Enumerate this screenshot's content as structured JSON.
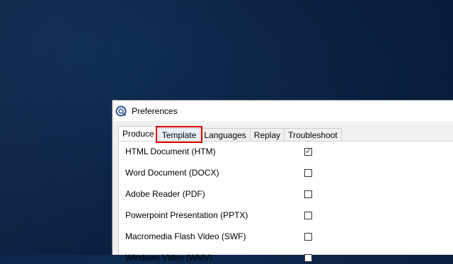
{
  "window": {
    "title": "Preferences"
  },
  "tabs": [
    {
      "label": "Produce"
    },
    {
      "label": "Template"
    },
    {
      "label": "Languages"
    },
    {
      "label": "Replay"
    },
    {
      "label": "Troubleshoot"
    }
  ],
  "options": [
    {
      "label": "HTML Document (HTM)",
      "checked": true
    },
    {
      "label": "Word Document (DOCX)",
      "checked": false
    },
    {
      "label": "Adobe Reader (PDF)",
      "checked": false
    },
    {
      "label": "Powerpoint Presentation (PPTX)",
      "checked": false
    },
    {
      "label": "Macromedia Flash Video (SWF)",
      "checked": false
    },
    {
      "label": "Windows Video (WMV)",
      "checked": false
    }
  ],
  "colors": {
    "highlight": "#e00000",
    "desktop": "#0b2448"
  }
}
